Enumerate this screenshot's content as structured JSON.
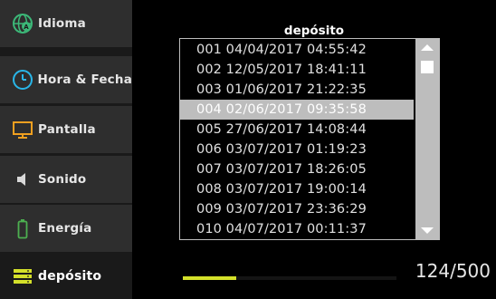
{
  "sidebar": {
    "items": [
      {
        "label": "Idioma",
        "icon": "globe-icon"
      },
      {
        "label": "Hora & Fecha",
        "icon": "clock-icon"
      },
      {
        "label": "Pantalla",
        "icon": "monitor-icon"
      },
      {
        "label": "Sonido",
        "icon": "speaker-icon"
      },
      {
        "label": "Energía",
        "icon": "battery-icon"
      },
      {
        "label": "depósito",
        "icon": "storage-icon",
        "active": true
      }
    ]
  },
  "main": {
    "title": "depósito",
    "records": [
      "001 04/04/2017 04:55:42",
      "002 12/05/2017 18:41:11",
      "003 01/06/2017 21:22:35",
      "004 02/06/2017 09:35:58",
      "005 27/06/2017 14:08:44",
      "006 03/07/2017 01:19:23",
      "007 03/07/2017 18:26:05",
      "008 03/07/2017 19:00:14",
      "009 03/07/2017 23:36:29",
      "010 04/07/2017 00:11:37"
    ],
    "selected_index": 3,
    "counter": "124/500",
    "usage_fraction": 0.248
  },
  "colors": {
    "accent": "#d4e02a",
    "globe_green": "#3cb878",
    "clock_cyan": "#29b6e8",
    "monitor_orange": "#f0a020",
    "battery_green": "#4caf50"
  }
}
